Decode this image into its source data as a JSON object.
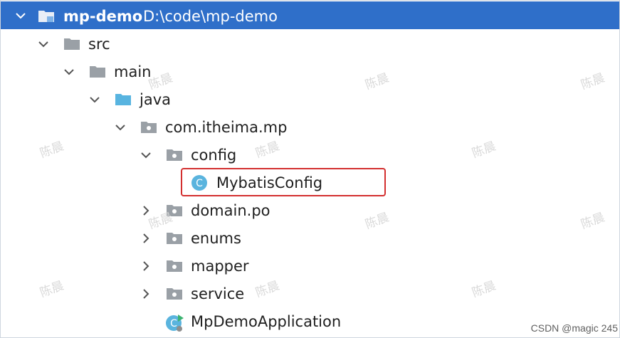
{
  "project": {
    "name": "mp-demo",
    "path": "D:\\code\\mp-demo"
  },
  "tree": {
    "src": "src",
    "main": "main",
    "java": "java",
    "package": "com.itheima.mp",
    "config": "config",
    "mybatis_config": "MybatisConfig",
    "domain_po": "domain.po",
    "enums": "enums",
    "mapper": "mapper",
    "service": "service",
    "application": "MpDemoApplication"
  },
  "watermark_text": "陈晨",
  "footer_credit": "CSDN @magic 245",
  "colors": {
    "selection": "#2f6fc9",
    "folder_gray": "#9aa0a6",
    "java_folder": "#58b4e0",
    "class_icon": "#5ab4de",
    "highlight_border": "#d32f2f"
  }
}
